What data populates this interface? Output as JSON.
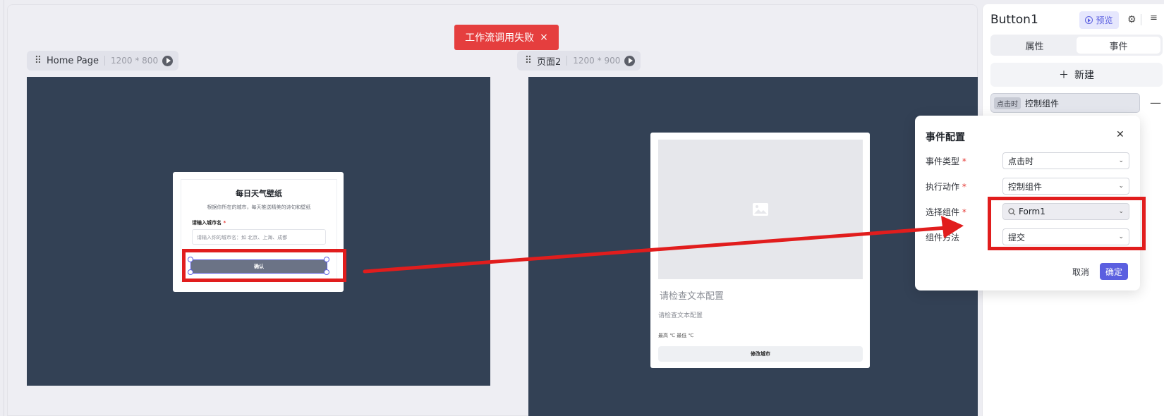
{
  "toast": {
    "message": "工作流调用失败",
    "close": "×"
  },
  "pages": [
    {
      "name": "Home Page",
      "size": "1200 * 800"
    },
    {
      "name": "页面2",
      "size": "1200 * 900"
    }
  ],
  "form_card": {
    "title": "每日天气壁纸",
    "description": "根据你所在的城市，每天推送精美的诗句和壁纸",
    "city_label": "请输入城市名",
    "required_mark": "*",
    "city_placeholder": "请输入你的城市名：如 北京、上海、成都",
    "confirm": "确认"
  },
  "weather_card": {
    "title": "请检查文本配置",
    "subtitle": "请检查文本配置",
    "temperature": "最高 ℃ 最低 ℃",
    "button": "修改城市"
  },
  "right_panel": {
    "component": "Button1",
    "preview": "预览",
    "tabs": [
      {
        "label": "属性",
        "active": false
      },
      {
        "label": "事件",
        "active": true
      }
    ],
    "new_button": "新建",
    "event": {
      "trigger_tag": "点击时",
      "action": "控制组件"
    }
  },
  "dialog": {
    "title": "事件配置",
    "fields": [
      {
        "label": "事件类型",
        "value": "点击时"
      },
      {
        "label": "执行动作",
        "value": "控制组件"
      },
      {
        "label": "选择组件",
        "value": "Form1"
      },
      {
        "label": "组件方法",
        "value": "提交"
      }
    ],
    "required_mark": "*",
    "cancel": "取消",
    "confirm": "确定"
  },
  "colors": {
    "accent": "#5b5fe0",
    "error": "#e53e3e",
    "artboard": "#334155",
    "annotation": "#e11d1d"
  }
}
